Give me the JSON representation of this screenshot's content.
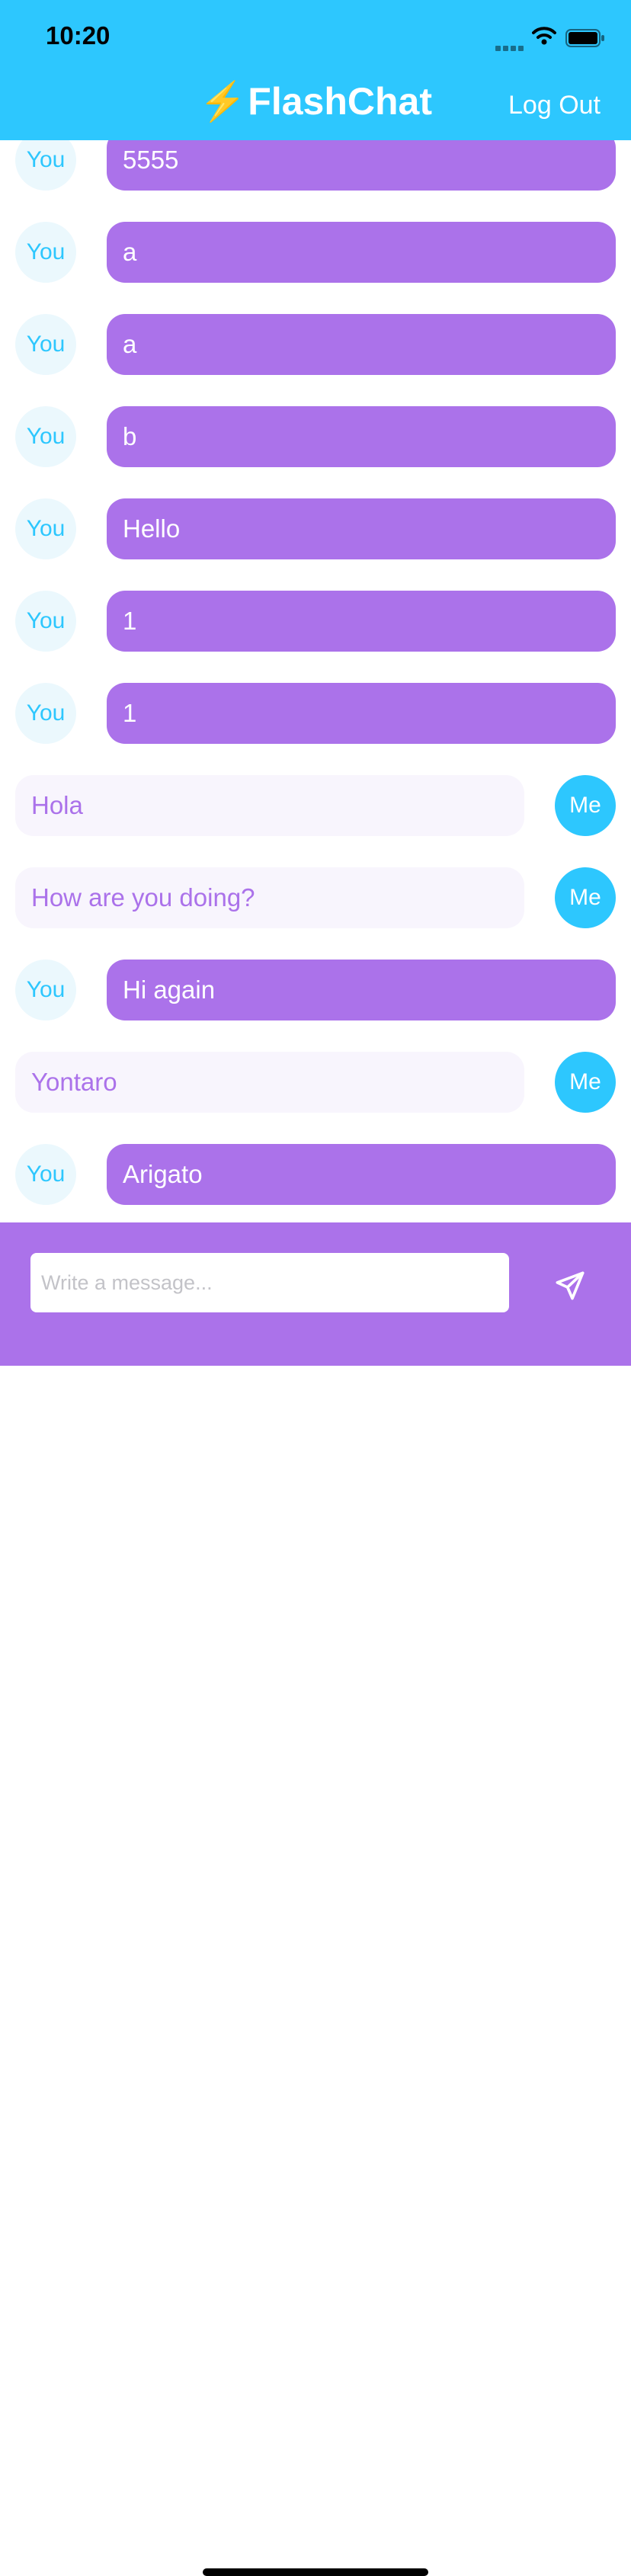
{
  "status_bar": {
    "time": "10:20"
  },
  "header": {
    "bolt": "⚡️",
    "title": "FlashChat",
    "logout_label": "Log Out"
  },
  "messages": [
    {
      "sender": "You",
      "text": "5555"
    },
    {
      "sender": "You",
      "text": "a"
    },
    {
      "sender": "You",
      "text": "a"
    },
    {
      "sender": "You",
      "text": "b"
    },
    {
      "sender": "You",
      "text": "Hello"
    },
    {
      "sender": "You",
      "text": "1"
    },
    {
      "sender": "You",
      "text": "1"
    },
    {
      "sender": "Me",
      "text": "Hola"
    },
    {
      "sender": "Me",
      "text": "How are you doing?"
    },
    {
      "sender": "You",
      "text": "Hi again"
    },
    {
      "sender": "Me",
      "text": "Yontaro"
    },
    {
      "sender": "You",
      "text": "Arigato"
    }
  ],
  "composer": {
    "placeholder": "Write a message...",
    "value": ""
  },
  "icons": {
    "signal": "signal-icon",
    "wifi": "wifi-icon",
    "battery": "battery-icon",
    "send": "paper-plane-icon"
  },
  "colors": {
    "header": "#2dc7fe",
    "other_bubble": "#ab72ea",
    "my_bubble": "#f8f5fd",
    "other_avatar_bg": "#ebf8fd",
    "my_avatar_bg": "#2dc7fe",
    "composer": "#ab72ea"
  }
}
